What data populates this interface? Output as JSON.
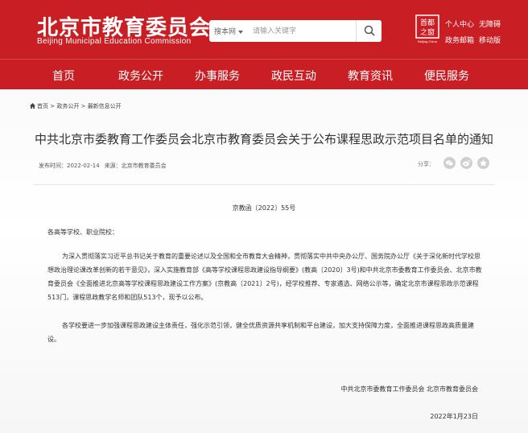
{
  "header": {
    "logo_cn": "北京市教育委员会",
    "logo_en": "Beijing Municipal Education Commission",
    "search": {
      "scope": "搜本网",
      "placeholder": "请输入关键字"
    },
    "emblem_label": "首都之窗",
    "user_links": [
      "个人中心",
      "无障碍",
      "政务邮箱",
      "移动版"
    ]
  },
  "nav": {
    "items": [
      "首页",
      "政务公开",
      "办事服务",
      "政民互动",
      "教育资讯",
      "便民服务"
    ]
  },
  "breadcrumb": [
    "首页",
    ">",
    "政务公开",
    ">",
    "最新信息公开"
  ],
  "article": {
    "title": "中共北京市委教育工作委员会北京市教育委员会关于公布课程思政示范项目名单的通知",
    "publish_label": "发布时间：2022-02-14",
    "source_label": "来源：北京市教育委员会",
    "share_label": "分享：",
    "doc_number": "京教函〔2022〕55号",
    "salutation": "各高等学校、职业院校：",
    "paragraph1": "为深入贯彻落实习近平总书记关于教育的重要论述以及全国和全市教育大会精神，贯彻落实中共中央办公厅、国务院办公厅《关于深化新时代学校思想政治理论课改革创新的若干意见》，深入实施教育部《高等学校课程思政建设指导纲要》(教高〔2020〕3号)和中共北京市委教育工作委员会、北京市教育委员会《全面推进北京高等学校课程思政建设工作方案》(京教高〔2021〕2号)，经学校推荐、专家遴选、网络公示等，确定北京市课程思政示范课程513门，课程思政教学名师和团队513个，现予以公布。",
    "paragraph2": "各学校要进一步加强课程思政建设主体责任，强化示范引领，健全优质资源共享机制和平台建设，加大支持保障力度，全面推进课程思政高质量建设。",
    "signer": "中共北京市委教育工作委员会 北京市教育委员会",
    "date": "2022年1月23日"
  },
  "colors": {
    "brand_red": "#c81e24",
    "text": "#333333"
  }
}
